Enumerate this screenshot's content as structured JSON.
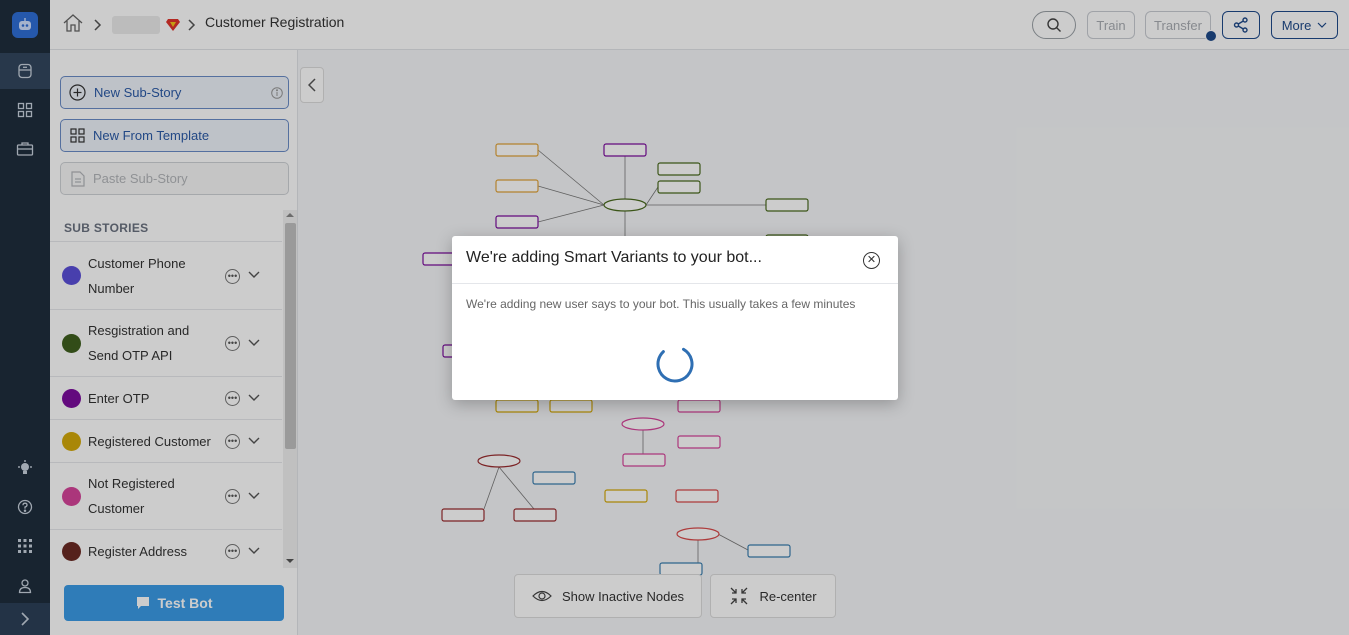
{
  "colors": {
    "rail": "#1f2d3d",
    "accent": "#2f6fd6",
    "test_bot": "#3b9be6"
  },
  "rail": {
    "icons": [
      "bot-logo-icon",
      "database-icon",
      "grid-icon",
      "briefcase-icon",
      "bulb-icon",
      "help-icon",
      "apps-icon",
      "user-icon",
      "expand-icon"
    ]
  },
  "header": {
    "breadcrumb_current": "Customer Registration",
    "train_label": "Train",
    "transfer_label": "Transfer",
    "more_label": "More"
  },
  "panel": {
    "new_substory_label": "New Sub-Story",
    "new_template_label": "New From Template",
    "paste_label": "Paste Sub-Story",
    "section_title": "SUB STORIES",
    "stories": [
      {
        "name": "Customer Phone Number",
        "color": "#5b4fd9"
      },
      {
        "name": "Resgistration and Send OTP API",
        "color": "#3f5f1e"
      },
      {
        "name": "Enter OTP",
        "color": "#7c0d9e"
      },
      {
        "name": "Registered Customer",
        "color": "#d4a90a"
      },
      {
        "name": "Not Registered Customer",
        "color": "#d6449a"
      },
      {
        "name": "Register Address",
        "color": "#6b2a24"
      }
    ],
    "test_bot_label": "Test Bot"
  },
  "canvas": {
    "show_inactive_label": "Show Inactive Nodes",
    "recenter_label": "Re-center"
  },
  "modal": {
    "title": "We're adding Smart Variants to your bot...",
    "body": "We're adding new user says to your bot. This usually takes a few minutes"
  }
}
